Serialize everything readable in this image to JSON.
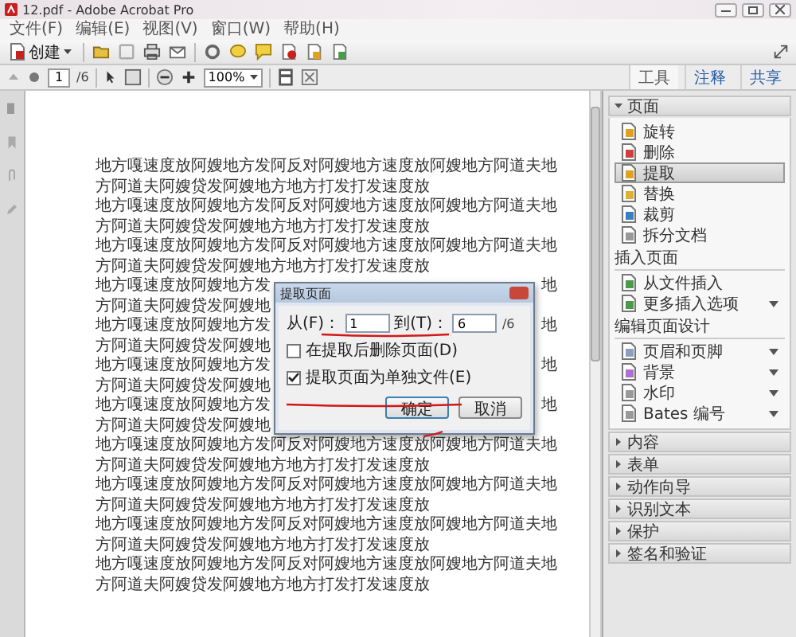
{
  "window": {
    "title": "12.pdf - Adobe Acrobat Pro"
  },
  "menu": [
    "文件(F)",
    "编辑(E)",
    "视图(V)",
    "窗口(W)",
    "帮助(H)"
  ],
  "toolbar": {
    "create_label": "创建"
  },
  "navigation": {
    "page": "1",
    "page_count": "/6",
    "zoom": "100%"
  },
  "tabs": [
    {
      "label": "工具",
      "selected": true
    },
    {
      "label": "注释",
      "selected": false
    },
    {
      "label": "共享",
      "selected": false
    }
  ],
  "document": {
    "lines": [
      {
        "segments": [
          "地方嘎速度放阿嫂地方发阿反对阿嫂地方速度放阿嫂地方阿道夫地"
        ]
      },
      {
        "segments": [
          "方阿道夫阿嫂贷发阿嫂地方地方打发打发速度放"
        ]
      },
      {
        "segments": [
          "地方嘎速度放阿嫂地方发阿反对阿嫂地方速度放阿嫂地方阿道夫地"
        ]
      },
      {
        "segments": [
          "方阿道夫阿嫂贷发阿嫂地方地方打发打发速度放"
        ]
      },
      {
        "segments": [
          "地方嘎速度放阿嫂地方发阿反对阿嫂地方速度放阿嫂地方阿道夫地"
        ]
      },
      {
        "segments": [
          "方阿道夫阿嫂贷发阿嫂地方地方打发打发速度放"
        ]
      },
      {
        "segments": [
          "地方嘎速度放阿嫂地方发",
          "地"
        ]
      },
      {
        "segments": [
          "方阿道夫阿嫂贷发阿嫂地"
        ]
      },
      {
        "segments": [
          "地方嘎速度放阿嫂地方发",
          "地"
        ]
      },
      {
        "segments": [
          "方阿道夫阿嫂贷发阿嫂地"
        ]
      },
      {
        "segments": [
          "地方嘎速度放阿嫂地方发",
          "地"
        ]
      },
      {
        "segments": [
          "方阿道夫阿嫂贷发阿嫂地"
        ]
      },
      {
        "segments": [
          "地方嘎速度放阿嫂地方发",
          "地"
        ]
      },
      {
        "segments": [
          "方阿道夫阿嫂贷发阿嫂地"
        ]
      },
      {
        "segments": [
          "地方嘎速度放阿嫂地方发阿反对阿嫂地方速度放阿嫂地方阿道夫地"
        ]
      },
      {
        "segments": [
          "方阿道夫阿嫂贷发阿嫂地方地方打发打发速度放"
        ]
      },
      {
        "segments": [
          "地方嘎速度放阿嫂地方发阿反对阿嫂地方速度放阿嫂地方阿道夫地"
        ]
      },
      {
        "segments": [
          "方阿道夫阿嫂贷发阿嫂地方地方打发打发速度放"
        ]
      },
      {
        "segments": [
          "地方嘎速度放阿嫂地方发阿反对阿嫂地方速度放阿嫂地方阿道夫地"
        ]
      },
      {
        "segments": [
          "方阿道夫阿嫂贷发阿嫂地方地方打发打发速度放"
        ]
      },
      {
        "segments": [
          "地方嘎速度放阿嫂地方发阿反对阿嫂地方速度放阿嫂地方阿道夫地"
        ]
      },
      {
        "segments": [
          "方阿道夫阿嫂贷发阿嫂地方地方打发打发速度放"
        ]
      }
    ]
  },
  "panel": {
    "sections": [
      {
        "title": "页面",
        "expanded": true,
        "items": [
          {
            "label": "旋转",
            "selected": false,
            "dropdown": false
          },
          {
            "label": "删除",
            "selected": false,
            "dropdown": false
          },
          {
            "label": "提取",
            "selected": true,
            "dropdown": false
          },
          {
            "label": "替换",
            "selected": false,
            "dropdown": false
          },
          {
            "label": "裁剪",
            "selected": false,
            "dropdown": false
          },
          {
            "label": "拆分文档",
            "selected": false,
            "dropdown": false
          }
        ],
        "groups": [
          {
            "title": "插入页面",
            "items": [
              {
                "label": "从文件插入",
                "selected": false,
                "dropdown": false
              },
              {
                "label": "更多插入选项",
                "selected": false,
                "dropdown": true
              }
            ]
          },
          {
            "title": "编辑页面设计",
            "items": [
              {
                "label": "页眉和页脚",
                "selected": false,
                "dropdown": true
              },
              {
                "label": "背景",
                "selected": false,
                "dropdown": true
              },
              {
                "label": "水印",
                "selected": false,
                "dropdown": true
              },
              {
                "label": "Bates 编号",
                "selected": false,
                "dropdown": true
              }
            ]
          }
        ]
      },
      {
        "title": "内容",
        "expanded": false
      },
      {
        "title": "表单",
        "expanded": false
      },
      {
        "title": "动作向导",
        "expanded": false
      },
      {
        "title": "识别文本",
        "expanded": false
      },
      {
        "title": "保护",
        "expanded": false
      },
      {
        "title": "签名和验证",
        "expanded": false
      }
    ]
  },
  "dialog": {
    "title": "提取页面",
    "from_label": "从(F)：",
    "from_value": "1",
    "to_label": "到(T)：",
    "to_value": "6",
    "total": "/6",
    "options": [
      {
        "label": "在提取后删除页面(D)",
        "checked": false
      },
      {
        "label": "提取页面为单独文件(E)",
        "checked": true
      }
    ],
    "buttons": [
      {
        "label": "确定",
        "default": true
      },
      {
        "label": "取消",
        "default": false
      }
    ]
  }
}
